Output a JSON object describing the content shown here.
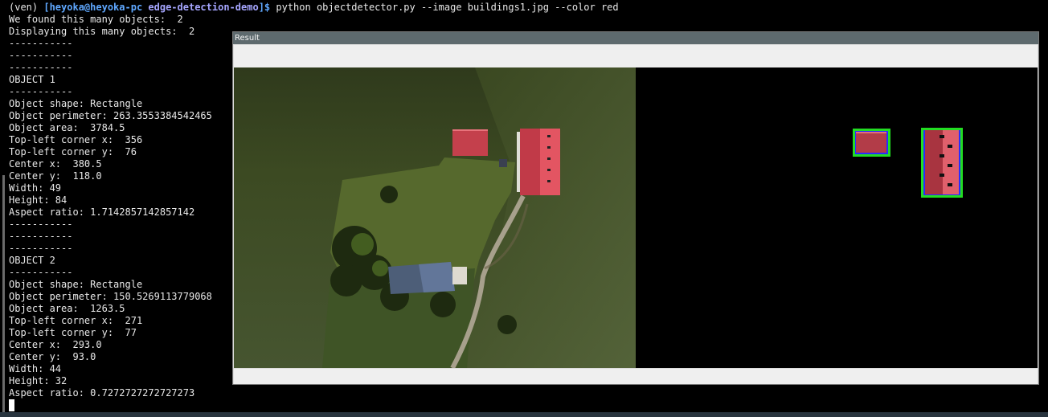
{
  "terminal": {
    "prompt": {
      "venv": "(ven) ",
      "user_host": "[heyoka@heyoka-pc",
      "dir": " edge-detection-demo",
      "end": "]$",
      "command": " python objectdetector.py --image buildings1.jpg --color red"
    },
    "output": [
      "We found this many objects:  2",
      "Displaying this many objects:  2",
      "-----------",
      "-----------",
      "-----------",
      "OBJECT 1",
      "-----------",
      "Object shape: Rectangle",
      "Object perimeter: 263.3553384542465",
      "Object area:  3784.5",
      "Top-left corner x:  356",
      "Top-left corner y:  76",
      "Center x:  380.5",
      "Center y:  118.0",
      "Width: 49",
      "Height: 84",
      "Aspect ratio: 1.7142857142857142",
      "-----------",
      "-----------",
      "-----------",
      "OBJECT 2",
      "-----------",
      "Object shape: Rectangle",
      "Object perimeter: 150.5269113779068",
      "Object area:  1263.5",
      "Top-left corner x:  271",
      "Top-left corner y:  77",
      "Center x:  293.0",
      "Center y:  93.0",
      "Width: 44",
      "Height: 32",
      "Aspect ratio: 0.7272727272727273"
    ]
  },
  "result_window": {
    "title": "Result",
    "colors": {
      "detection_box": "#22dd22",
      "detection_inner": "#2a2aff",
      "roof_red": "#c4404c",
      "grass": "#4a5a2a"
    }
  }
}
